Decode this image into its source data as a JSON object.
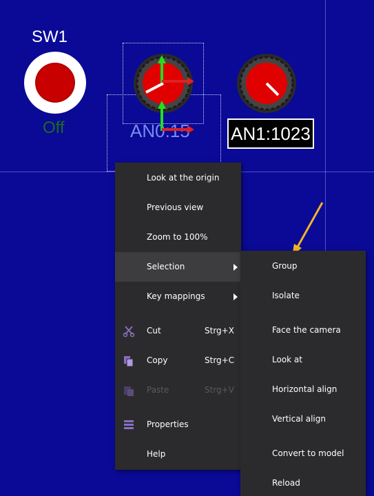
{
  "canvas": {
    "switch_title": "SW1",
    "switch_state": "Off",
    "knob0_label": "AN0:15",
    "knob1_label": "AN1:1023"
  },
  "context_menu": {
    "items": [
      {
        "label": "Look at the origin"
      },
      {
        "label": "Previous view"
      },
      {
        "label": "Zoom to 100%"
      },
      {
        "label": "Selection",
        "has_submenu": true,
        "highlighted": true
      },
      {
        "label": "Key mappings",
        "has_submenu": true
      },
      {
        "label": "Cut",
        "shortcut": "Strg+X",
        "icon": "scissors-icon"
      },
      {
        "label": "Copy",
        "shortcut": "Strg+C",
        "icon": "copy-icon"
      },
      {
        "label": "Paste",
        "shortcut": "Strg+V",
        "icon": "paste-icon",
        "disabled": true
      },
      {
        "label": "Properties",
        "icon": "properties-icon"
      },
      {
        "label": "Help"
      }
    ]
  },
  "submenu": {
    "items": [
      {
        "label": "Group"
      },
      {
        "label": "Isolate"
      },
      {
        "label": "Face the camera"
      },
      {
        "label": "Look at"
      },
      {
        "label": "Horizontal align"
      },
      {
        "label": "Vertical align"
      },
      {
        "label": "Convert to model"
      },
      {
        "label": "Reload"
      }
    ]
  },
  "colors": {
    "background": "#0a0a96",
    "menu_bg": "#2b2b2d",
    "menu_highlight": "#3d3d40",
    "icon_purple": "#8a6fc2",
    "annotation_arrow": "#f0b429",
    "button_red": "#c00000",
    "switch_state_green": "#1d6b1d"
  }
}
